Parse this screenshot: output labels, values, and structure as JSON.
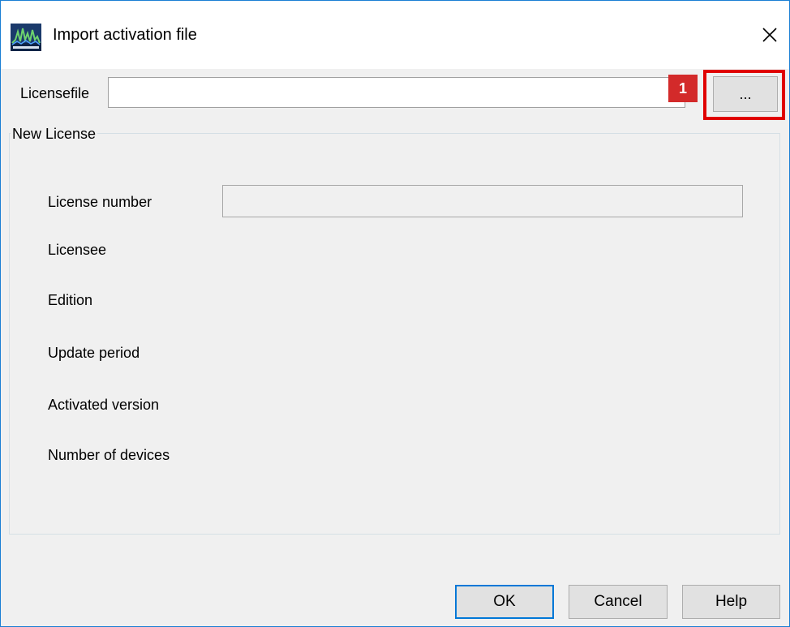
{
  "window": {
    "title": "Import activation file",
    "app_icon": "spectrum-analyzer-app-icon",
    "close_icon": "close-icon",
    "accent_color": "#0078d7"
  },
  "licensefile": {
    "label": "Licensefile",
    "value": "",
    "browse_label": "...",
    "annotation_badge": "1",
    "annotation_color": "#e00000"
  },
  "new_license": {
    "group_label": "New License",
    "fields": {
      "license_number": {
        "label": "License number",
        "value": ""
      },
      "licensee": "Licensee",
      "edition": "Edition",
      "update_period": "Update period",
      "activated_version": "Activated version",
      "number_of_devices": "Number of devices"
    }
  },
  "buttons": {
    "ok": "OK",
    "cancel": "Cancel",
    "help": "Help"
  }
}
